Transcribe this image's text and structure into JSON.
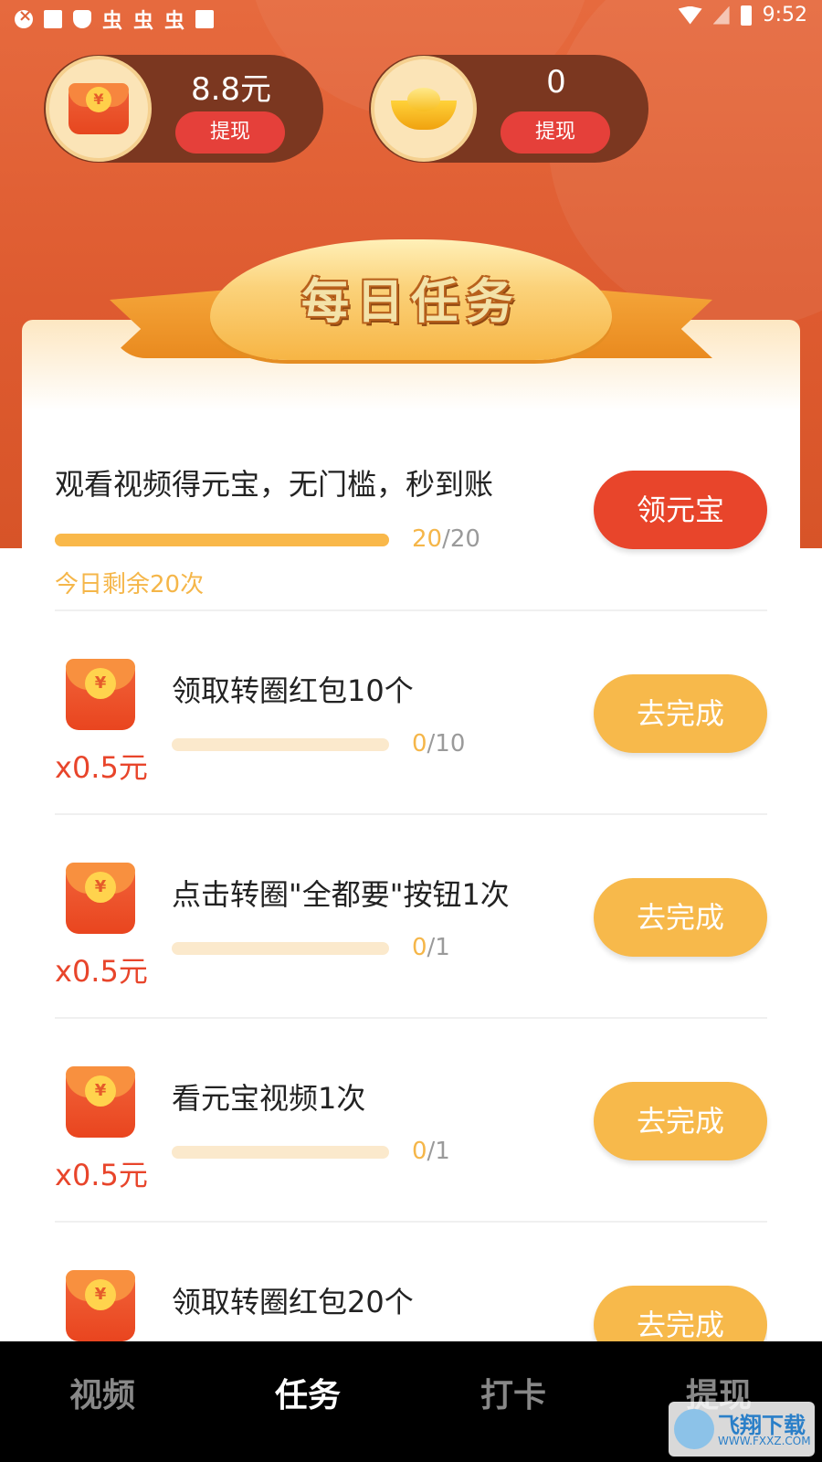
{
  "status_bar": {
    "icons": [
      "close-circle-icon",
      "image-icon",
      "shield-icon",
      "bug-icon",
      "bug-icon",
      "bug-icon",
      "a-box-icon"
    ],
    "bug_glyph": "虫",
    "time": "9:52"
  },
  "wallet": {
    "cash_amount": "8.8元",
    "cash_button": "提现",
    "ingot_amount": "0",
    "ingot_button": "提现",
    "yen": "¥"
  },
  "banner": {
    "title": "每日任务"
  },
  "tasks": {
    "main": {
      "title": "观看视频得元宝，无门槛，秒到账",
      "done": "20",
      "total": "/20",
      "progress": 1.0,
      "remaining": "今日剩余20次",
      "button": "领元宝"
    },
    "items": [
      {
        "title": "领取转圈红包10个",
        "reward": "x0.5元",
        "done": "0",
        "total": "/10",
        "progress": 0.0,
        "button": "去完成"
      },
      {
        "title": "点击转圈\"全都要\"按钮1次",
        "reward": "x0.5元",
        "done": "0",
        "total": "/1",
        "progress": 0.0,
        "button": "去完成"
      },
      {
        "title": "看元宝视频1次",
        "reward": "x0.5元",
        "done": "0",
        "total": "/1",
        "progress": 0.0,
        "button": "去完成"
      },
      {
        "title": "领取转圈红包20个",
        "button": "去完成"
      }
    ]
  },
  "nav": {
    "items": [
      "视频",
      "任务",
      "打卡",
      "提现"
    ],
    "active": "任务"
  },
  "watermark": {
    "title": "飞翔下载",
    "sub": "WWW.FXXZ.COM"
  },
  "colors": {
    "hero": "#de5b30",
    "primary_button": "#e8452b",
    "go_button": "#f7b94b",
    "progress_fill": "#f9b84a",
    "wallet_bg": "#7b3720"
  }
}
